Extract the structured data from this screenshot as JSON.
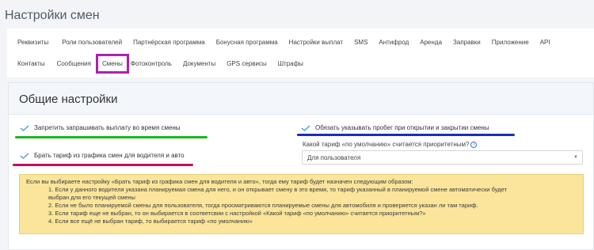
{
  "page": {
    "title": "Настройки смен"
  },
  "tabs": {
    "row1": [
      "Реквизиты",
      "Роли пользователей",
      "Партнёрская программа",
      "Бонусная программа",
      "Настройки выплат",
      "SMS",
      "Антифрод",
      "Аренда",
      "Заправки",
      "Приложение",
      "API"
    ],
    "row2": [
      "Контакты",
      "Сообщения",
      "Смены",
      "Фотоконтроль",
      "Документы",
      "GPS сервисы",
      "Штрафы"
    ],
    "active": "Смены"
  },
  "settings": {
    "title": "Общие настройки",
    "check_forbid_payout": "Запретить запрашивать выплату во время смены",
    "check_require_mileage": "Обязать указывать пробег при открытии и закрытии смены",
    "check_tariff_from_schedule": "Брать тариф из графика смен для водителя и авто",
    "default_tariff_label": "Какой тариф «по умолчанию» считается приоритетным?",
    "default_tariff_value": "Для пользователя"
  },
  "note": {
    "lines": [
      "Если вы выбираете настройку «Брать тариф из графика смен для водителя и авто», тогда ему тариф будет назначен следующим образом:",
      "1. Если у данного водителя указана планируемая смена для него, и он открывает смену в это время, то тариф указанный в планируемой смене автоматически будет",
      "выбран для его текущей смены",
      "2. Если не было планируемой смены для пользователя, тогда просматриваются планируемые смены для автомобиля и проверяется указан ли там тариф.",
      "3. Если тариф еще не выбран, то он выбирается в соответсвии с настройкой «Какой тариф «по умолчанию» считается приоритетным?»",
      "4. Если все ещё не выбран тариф, то выбирается тариф «по умолчанию»"
    ]
  },
  "colors": {
    "active_tab_outline": "#b01fb0",
    "underline_green": "#1fb51f",
    "underline_blue": "#1a2fb0",
    "underline_magenta": "#c0105a",
    "check_mark": "#3aa0d8",
    "note_bg": "#fbe59b"
  }
}
